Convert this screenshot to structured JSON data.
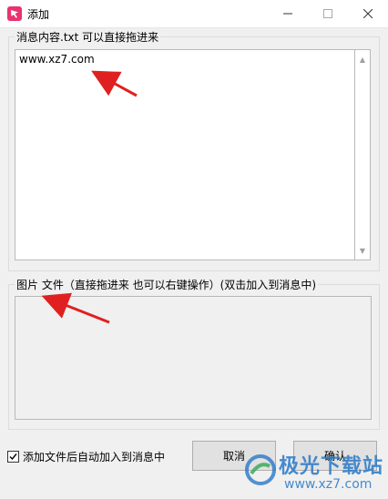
{
  "window": {
    "title": "添加"
  },
  "colors": {
    "accent": "#e8336e",
    "annotation_arrow": "#e02020",
    "watermark": "#2878c8"
  },
  "icons": {
    "app": "app-logo-icon",
    "minimize": "minimize-icon",
    "maximize": "maximize-icon",
    "close": "close-icon"
  },
  "message_group": {
    "label": "消息内容.txt 可以直接拖进来",
    "content": "www.xz7.com"
  },
  "files_group": {
    "label": "图片 文件（直接拖进来 也可以右键操作）(双击加入到消息中)"
  },
  "auto_add": {
    "label": "添加文件后自动加入到消息中",
    "checked": true
  },
  "buttons": {
    "cancel": "取消",
    "ok": "确认"
  },
  "watermark": {
    "main": "极光下载站",
    "sub": "www.xz7.com"
  }
}
